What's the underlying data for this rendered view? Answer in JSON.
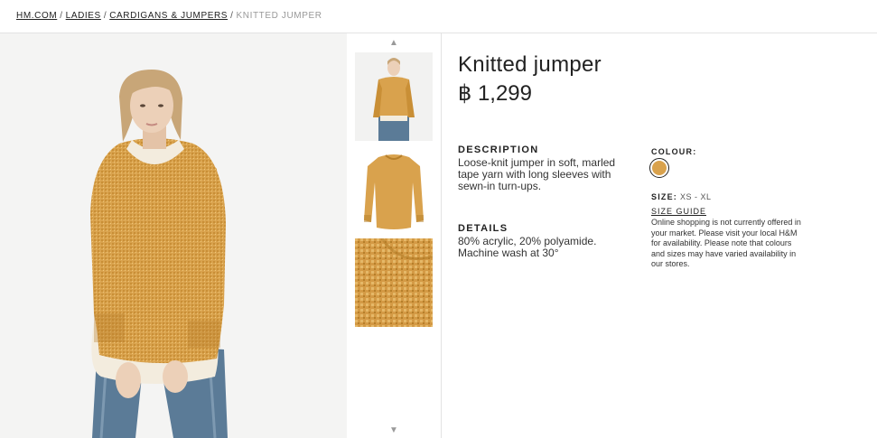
{
  "breadcrumb": {
    "items": [
      "HM.COM",
      "LADIES",
      "CARDIGANS & JUMPERS"
    ],
    "separator": "/",
    "current": "KNITTED JUMPER"
  },
  "gallery": {
    "main_image": "model-wearing-knitted-jumper",
    "thumbnails": [
      "model-front-view",
      "jumper-flat-view",
      "knit-texture-closeup"
    ],
    "up_arrow": "▲",
    "down_arrow": "▼"
  },
  "product": {
    "title": "Knitted jumper",
    "price": "฿ 1,299",
    "description_heading": "DESCRIPTION",
    "description_text": "Loose-knit jumper in soft, marled tape yarn with long sleeves with sewn-in turn-ups.",
    "details_heading": "DETAILS",
    "details_text": "80% acrylic, 20% polyamide. Machine wash at 30°",
    "colour_heading": "COLOUR:",
    "colour_swatch": "#d9a24d",
    "size_heading": "SIZE:",
    "size_range": "XS - XL",
    "size_guide_label": "SIZE GUIDE",
    "notice": "Online shopping is not currently offered in your market. Please visit your local H&M for availability. Please note that colours and sizes may have varied availability in our stores."
  },
  "colors": {
    "jumper": "#d9a24d",
    "jumper_dark": "#b67f2a",
    "shirt": "#f3ecde",
    "jeans": "#5b7b97",
    "skin": "#ecd0b8",
    "hair": "#c8a678"
  }
}
